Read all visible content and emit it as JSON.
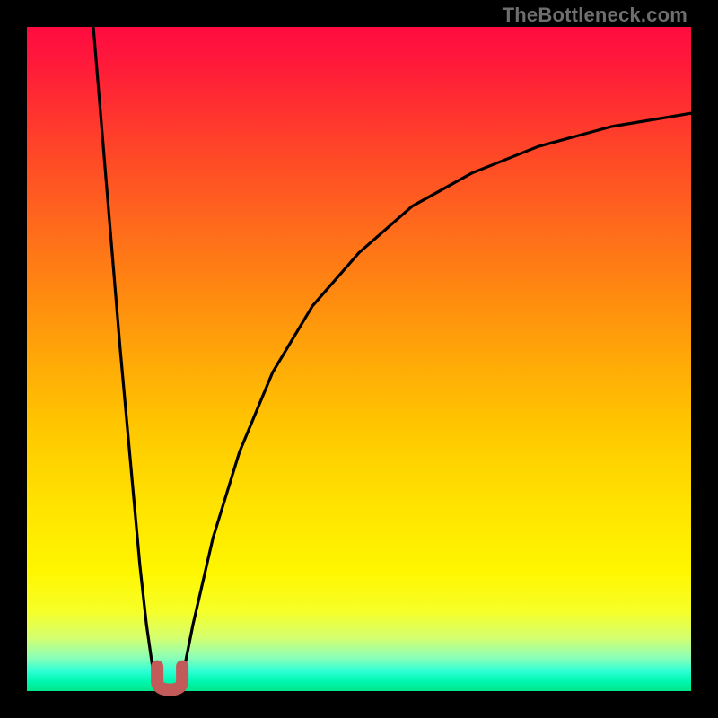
{
  "attribution": "TheBottleneck.com",
  "chart_data": {
    "type": "line",
    "title": "",
    "xlabel": "",
    "ylabel": "",
    "xlim": [
      0,
      100
    ],
    "ylim": [
      0,
      100
    ],
    "grid": false,
    "legend": false,
    "series": [
      {
        "name": "curve-left",
        "x": [
          10,
          11,
          12,
          13,
          14,
          15,
          16,
          17,
          18,
          19,
          20
        ],
        "y": [
          100,
          88,
          76,
          64,
          52,
          41,
          30,
          19,
          10,
          3,
          0
        ]
      },
      {
        "name": "curve-bottom-dip",
        "x": [
          20,
          20.5,
          21,
          21.5,
          22,
          22.5,
          23
        ],
        "y": [
          2,
          0.5,
          0,
          0,
          0,
          0.5,
          2
        ]
      },
      {
        "name": "curve-right",
        "x": [
          23,
          25,
          28,
          32,
          37,
          43,
          50,
          58,
          67,
          77,
          88,
          100
        ],
        "y": [
          0,
          10,
          23,
          36,
          48,
          58,
          66,
          73,
          78,
          82,
          85,
          87
        ]
      }
    ],
    "annotations": [
      {
        "name": "dip-marker",
        "shape": "u",
        "x_center": 21.5,
        "y": 1,
        "color": "#c35a5a"
      }
    ],
    "background_gradient": {
      "direction": "vertical",
      "stops": [
        {
          "pos": 0.0,
          "color": "#ff0b3f"
        },
        {
          "pos": 0.3,
          "color": "#ff6a1c"
        },
        {
          "pos": 0.6,
          "color": "#ffc600"
        },
        {
          "pos": 0.88,
          "color": "#f6ff28"
        },
        {
          "pos": 1.0,
          "color": "#00e68a"
        }
      ]
    }
  }
}
